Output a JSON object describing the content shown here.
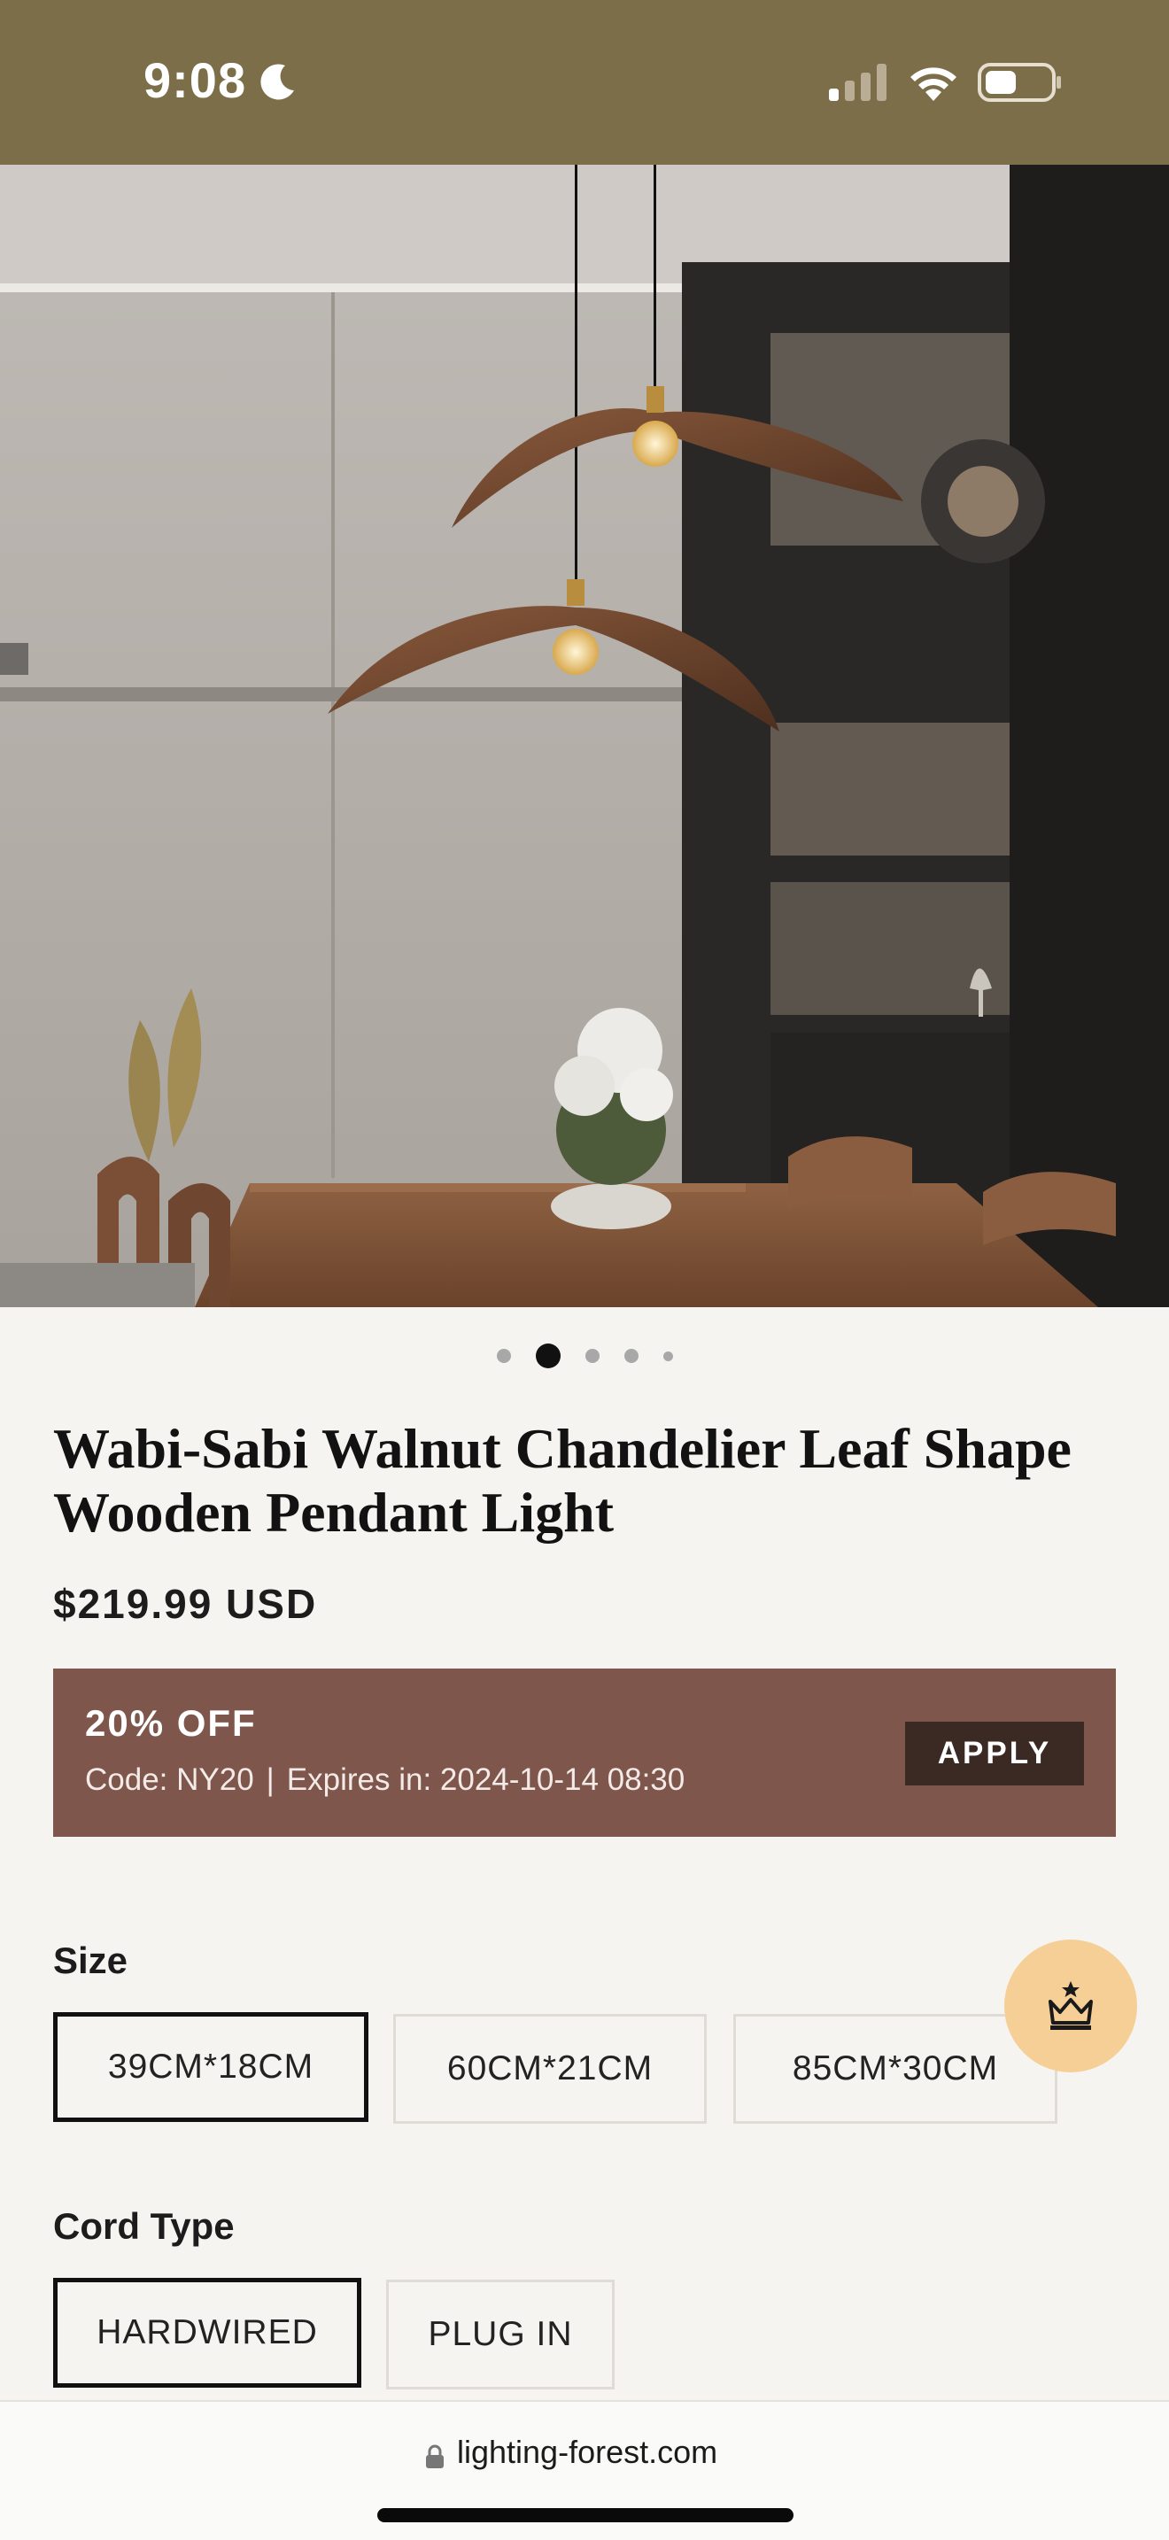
{
  "status_bar": {
    "time": "9:08",
    "icons": [
      "moon-icon",
      "cellular-signal-icon",
      "wifi-icon",
      "battery-icon"
    ]
  },
  "gallery": {
    "image_alt": "product-photo",
    "dots_count": 5,
    "active_dot": 2
  },
  "product": {
    "title": "Wabi-Sabi Walnut Chandelier Leaf Shape Wooden Pendant Light",
    "price": "$219.99 USD"
  },
  "coupon": {
    "headline": "20% OFF",
    "code_text": "Code: NY20",
    "separator": "|",
    "expires_text": "Expires in: 2024-10-14 08:30",
    "apply_label": "APPLY",
    "background_color": "#7e564b"
  },
  "size": {
    "label": "Size",
    "options": [
      "39CM*18CM",
      "60CM*21CM",
      "85CM*30CM"
    ],
    "selected": "39CM*18CM"
  },
  "cord_type": {
    "label": "Cord Type",
    "options": [
      "HARDWIRED",
      "PLUG IN"
    ],
    "selected": "HARDWIRED"
  },
  "floating_button": {
    "icon": "crown-icon",
    "color": "#f5cf96"
  },
  "browser": {
    "url": "lighting-forest.com",
    "icon": "lock-icon"
  },
  "colors": {
    "status_bar": "#7d6e4a",
    "page_background": "#f6f4f0"
  }
}
